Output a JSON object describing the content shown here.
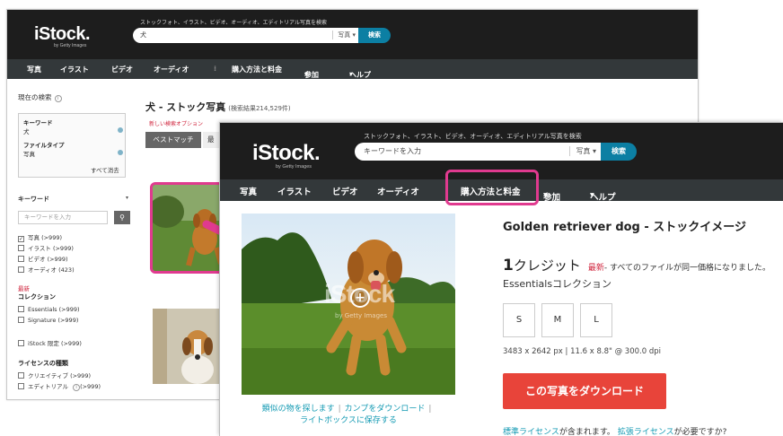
{
  "back": {
    "logo": "iStock.",
    "logo_sub": "by Getty Images",
    "tagline": "ストックフォト、イラスト、ビデオ、オーディオ、エディトリアル写真を検索",
    "search_value": "犬",
    "search_type": "写真",
    "search_button": "検索",
    "nav": [
      "写真",
      "イラスト",
      "ビデオ",
      "オーディオ",
      "購入方法と料金",
      "参加",
      "ヘルプ"
    ],
    "sidebar": {
      "current_search": "現在の検索",
      "filters": [
        {
          "label": "キーワード",
          "value": "犬"
        },
        {
          "label": "ファイルタイプ",
          "value": "写真"
        }
      ],
      "clear_all": "すべて消去",
      "keyword_title": "キーワード",
      "keyword_placeholder": "キーワードを入力",
      "types": [
        {
          "label": "写真",
          "count": "(>999)",
          "checked": true
        },
        {
          "label": "イラスト",
          "count": "(>999)",
          "checked": false
        },
        {
          "label": "ビデオ",
          "count": "(>999)",
          "checked": false
        },
        {
          "label": "オーディオ",
          "count": "(423)",
          "checked": false
        }
      ],
      "new_label": "最新",
      "collection_title": "コレクション",
      "collections": [
        {
          "label": "Essentials",
          "count": "(>999)"
        },
        {
          "label": "Signature",
          "count": "(>999)"
        }
      ],
      "istock_only": {
        "label": "iStock 限定",
        "count": "(>999)"
      },
      "license_title": "ライセンスの種類",
      "licenses": [
        {
          "label": "クリエイティブ",
          "count": "(>999)"
        },
        {
          "label": "エディトリアル",
          "count": "(>999)"
        }
      ]
    },
    "results_title": "犬 - ストック写真",
    "results_count": "(検索結果214,529件)",
    "new_search_option": "新しい検索オプション",
    "sort_best": "ベストマッチ",
    "sort_new": "最"
  },
  "front": {
    "logo": "iStock.",
    "logo_sub": "by Getty Images",
    "tagline": "ストックフォト、イラスト、ビデオ、オーディオ、エディトリアル写真を検索",
    "search_placeholder": "キーワードを入力",
    "search_type": "写真",
    "search_button": "検索",
    "nav": [
      "写真",
      "イラスト",
      "ビデオ",
      "オーディオ",
      "購入方法と料金",
      "参加",
      "ヘルプ"
    ],
    "watermark": "iStock",
    "watermark_sub": "by Getty Images",
    "link_similar": "類似の物を探します",
    "link_comp": "カンプをダウンロード",
    "link_lightbox": "ライトボックスに保存する",
    "title": "Golden retriever dog - ストックイメージ",
    "price_num": "1",
    "price_unit": "クレジット",
    "price_new": "最新",
    "price_note": "- すべてのファイルが同一価格になりました。",
    "collection": "Essentialsコレクション",
    "sizes": [
      "S",
      "M",
      "L"
    ],
    "dimensions": "3483 x 2642 px | 11.6 x 8.8\" @ 300.0 dpi",
    "download": "この写真をダウンロード",
    "license_std": "標準ライセンス",
    "license_mid": "が含まれます。",
    "license_ext": "拡張ライセンス",
    "license_end": "が必要ですか?"
  },
  "colors": {
    "highlight": "#e03a8f",
    "accent": "#0c7fa3",
    "download": "#e8443a",
    "link": "#139ab3",
    "new": "#d0243d"
  }
}
